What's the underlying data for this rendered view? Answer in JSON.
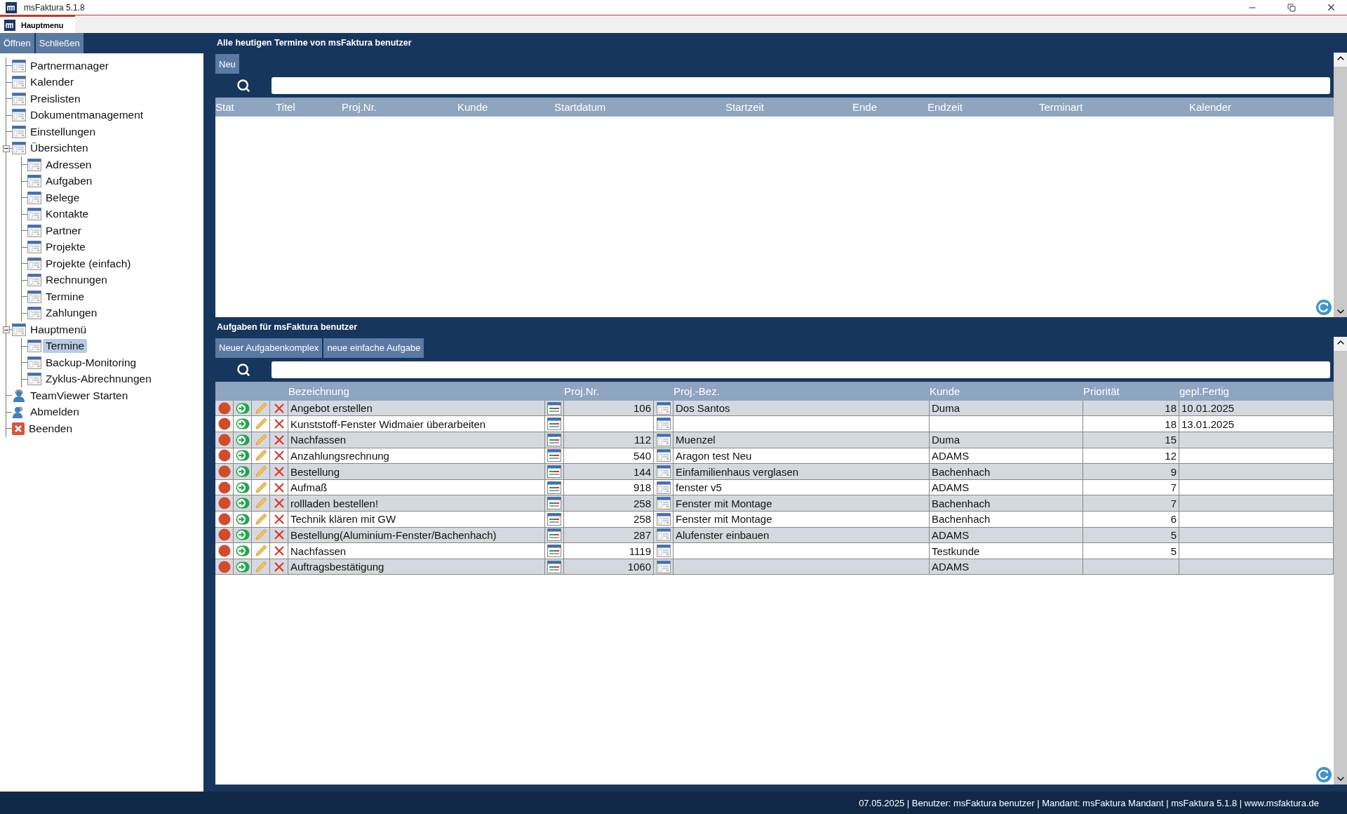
{
  "window": {
    "title": "msFaktura 5.1.8"
  },
  "tabs": [
    {
      "label": "Hauptmenu",
      "selected": true
    }
  ],
  "sidebar": {
    "buttons": [
      "Öffnen",
      "Schließen"
    ],
    "tree": [
      {
        "label": "Partnermanager",
        "kind": "window",
        "selected": false
      },
      {
        "label": "Kalender",
        "kind": "window",
        "selected": false
      },
      {
        "label": "Preislisten",
        "kind": "window",
        "selected": false
      },
      {
        "label": "Dokumentmanagement",
        "kind": "window",
        "selected": false
      },
      {
        "label": "Einstellungen",
        "kind": "window",
        "selected": false
      },
      {
        "label": "Übersichten",
        "kind": "window",
        "selected": false,
        "expanded": true,
        "children": [
          {
            "label": "Adressen",
            "kind": "window",
            "selected": false
          },
          {
            "label": "Aufgaben",
            "kind": "window",
            "selected": false
          },
          {
            "label": "Belege",
            "kind": "window",
            "selected": false
          },
          {
            "label": "Kontakte",
            "kind": "window",
            "selected": false
          },
          {
            "label": "Partner",
            "kind": "window",
            "selected": false
          },
          {
            "label": "Projekte",
            "kind": "window",
            "selected": false
          },
          {
            "label": "Projekte (einfach)",
            "kind": "window",
            "selected": false
          },
          {
            "label": "Rechnungen",
            "kind": "window",
            "selected": false
          },
          {
            "label": "Termine",
            "kind": "window",
            "selected": false
          },
          {
            "label": "Zahlungen",
            "kind": "window",
            "selected": false
          }
        ]
      },
      {
        "label": "Hauptmenü",
        "kind": "window",
        "selected": false,
        "expanded": true,
        "children": [
          {
            "label": "Termine",
            "kind": "window",
            "selected": true
          },
          {
            "label": "Backup-Monitoring",
            "kind": "window",
            "selected": false
          },
          {
            "label": "Zyklus-Abrechnungen",
            "kind": "window",
            "selected": false
          }
        ]
      },
      {
        "label": "TeamViewer Starten",
        "kind": "headset",
        "selected": false
      },
      {
        "label": "Abmelden",
        "kind": "person",
        "selected": false
      },
      {
        "label": "Beenden",
        "kind": "exit",
        "selected": false
      }
    ]
  },
  "appointments": {
    "title": "Alle heutigen Termine von  msFaktura benutzer",
    "buttons": [
      "Neu"
    ],
    "columns": [
      "Stat",
      "Titel",
      "Proj.Nr.",
      "Kunde",
      "Startdatum",
      "Startzeit",
      "Ende",
      "Endzeit",
      "Terminart",
      "Kalender"
    ]
  },
  "tasks": {
    "title": "Aufgaben für msFaktura benutzer",
    "buttons": [
      "Neuer Aufgabenkomplex",
      "neue einfache Aufgabe"
    ],
    "columns": [
      "Bezeichnung",
      "Proj.Nr.",
      "Proj.-Bez.",
      "Kunde",
      "Priorität",
      "gepl.Fertig"
    ],
    "rows": [
      {
        "title": "Angebot erstellen",
        "proj_nr": "106",
        "proj_bez": "Dos Santos",
        "kunde": "Duma",
        "prio": "18",
        "due": "10.01.2025"
      },
      {
        "title": "Kunststoff-Fenster Widmaier überarbeiten",
        "proj_nr": "",
        "proj_bez": "",
        "kunde": "",
        "prio": "18",
        "due": "13.01.2025"
      },
      {
        "title": "Nachfassen",
        "proj_nr": "112",
        "proj_bez": "Muenzel",
        "kunde": "Duma",
        "prio": "15",
        "due": ""
      },
      {
        "title": "Anzahlungsrechnung",
        "proj_nr": "540",
        "proj_bez": "Aragon test Neu",
        "kunde": "ADAMS",
        "prio": "12",
        "due": ""
      },
      {
        "title": "Bestellung",
        "proj_nr": "144",
        "proj_bez": "Einfamilienhaus verglasen",
        "kunde": "Bachenhach",
        "prio": "9",
        "due": ""
      },
      {
        "title": "Aufmaß",
        "proj_nr": "918",
        "proj_bez": "fenster v5",
        "kunde": "ADAMS",
        "prio": "7",
        "due": ""
      },
      {
        "title": "rollladen bestellen!",
        "proj_nr": "258",
        "proj_bez": "Fenster mit Montage",
        "kunde": "Bachenhach",
        "prio": "7",
        "due": ""
      },
      {
        "title": "Technik klären mit GW",
        "proj_nr": "258",
        "proj_bez": "Fenster mit Montage",
        "kunde": "Bachenhach",
        "prio": "6",
        "due": ""
      },
      {
        "title": "Bestellung(Aluminium-Fenster/Bachenhach)",
        "proj_nr": "287",
        "proj_bez": "Alufenster einbauen",
        "kunde": "ADAMS",
        "prio": "5",
        "due": ""
      },
      {
        "title": "Nachfassen",
        "proj_nr": "1119",
        "proj_bez": "",
        "kunde": "Testkunde",
        "prio": "5",
        "due": ""
      },
      {
        "title": "Auftragsbestätigung",
        "proj_nr": "1060",
        "proj_bez": "",
        "kunde": "ADAMS",
        "prio": "",
        "due": ""
      }
    ]
  },
  "status_bar": "07.05.2025 | Benutzer: msFaktura benutzer | Mandant: msFaktura Mandant |  msFaktura 5.1.8 | www.msfaktura.de"
}
